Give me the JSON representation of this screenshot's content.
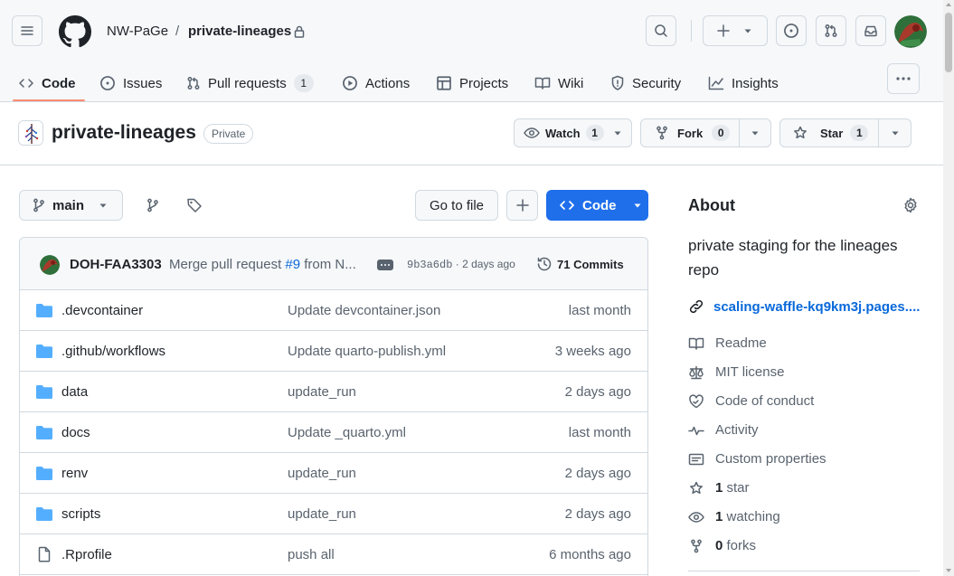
{
  "header": {
    "owner": "NW-PaGe",
    "separator": "/",
    "repo": "private-lineages",
    "icons": [
      "hamburger-menu-icon",
      "github-logo-icon",
      "lock-icon",
      "search-icon",
      "plus-icon",
      "issue-opened-icon",
      "git-pull-request-icon",
      "inbox-icon"
    ]
  },
  "tabs": [
    {
      "label": "Code",
      "icon": "code-icon",
      "active": true
    },
    {
      "label": "Issues",
      "icon": "issue-opened-icon"
    },
    {
      "label": "Pull requests",
      "icon": "git-pull-request-icon",
      "count": "1"
    },
    {
      "label": "Actions",
      "icon": "play-icon"
    },
    {
      "label": "Projects",
      "icon": "table-icon"
    },
    {
      "label": "Wiki",
      "icon": "book-icon"
    },
    {
      "label": "Security",
      "icon": "shield-icon"
    },
    {
      "label": "Insights",
      "icon": "graph-icon"
    }
  ],
  "repo_header": {
    "name": "private-lineages",
    "visibility": "Private",
    "watch": {
      "label": "Watch",
      "count": "1"
    },
    "fork": {
      "label": "Fork",
      "count": "0"
    },
    "star": {
      "label": "Star",
      "count": "1"
    }
  },
  "toolbar": {
    "branch": "main",
    "goto_file": "Go to file",
    "code_label": "Code"
  },
  "latest_commit": {
    "author": "DOH-FAA3303",
    "message_prefix": "Merge pull request ",
    "pr_ref": "#9",
    "message_suffix": " from N...",
    "sha": "9b3a6db",
    "separator": " · ",
    "ago": "2 days ago",
    "commits_label": "71 Commits"
  },
  "files": [
    {
      "type": "dir",
      "name": ".devcontainer",
      "message": "Update devcontainer.json",
      "date": "last month"
    },
    {
      "type": "dir",
      "name": ".github/workflows",
      "message": "Update quarto-publish.yml",
      "date": "3 weeks ago"
    },
    {
      "type": "dir",
      "name": "data",
      "message": "update_run",
      "date": "2 days ago"
    },
    {
      "type": "dir",
      "name": "docs",
      "message": "Update _quarto.yml",
      "date": "last month"
    },
    {
      "type": "dir",
      "name": "renv",
      "message": "update_run",
      "date": "2 days ago"
    },
    {
      "type": "dir",
      "name": "scripts",
      "message": "update_run",
      "date": "2 days ago"
    },
    {
      "type": "file",
      "name": ".Rprofile",
      "message": "push all",
      "date": "6 months ago"
    }
  ],
  "about": {
    "title": "About",
    "description": "private staging for the lineages repo",
    "website": "scaling-waffle-kq9km3j.pages....",
    "items": [
      {
        "icon": "book-icon",
        "label": "Readme"
      },
      {
        "icon": "law-icon",
        "label": "MIT license"
      },
      {
        "icon": "code-of-conduct-icon",
        "label": "Code of conduct"
      },
      {
        "icon": "pulse-icon",
        "label": "Activity"
      },
      {
        "icon": "note-icon",
        "label": "Custom properties"
      },
      {
        "icon": "star-icon",
        "count": "1",
        "label": " star"
      },
      {
        "icon": "eye-icon",
        "count": "1",
        "label": " watching"
      },
      {
        "icon": "repo-forked-icon",
        "count": "0",
        "label": " forks"
      }
    ]
  },
  "colors": {
    "accent": "#1f6feb",
    "link": "#0969da",
    "tab_underline": "#fd8c73",
    "folder": "#54aeff",
    "muted": "#59636e"
  }
}
